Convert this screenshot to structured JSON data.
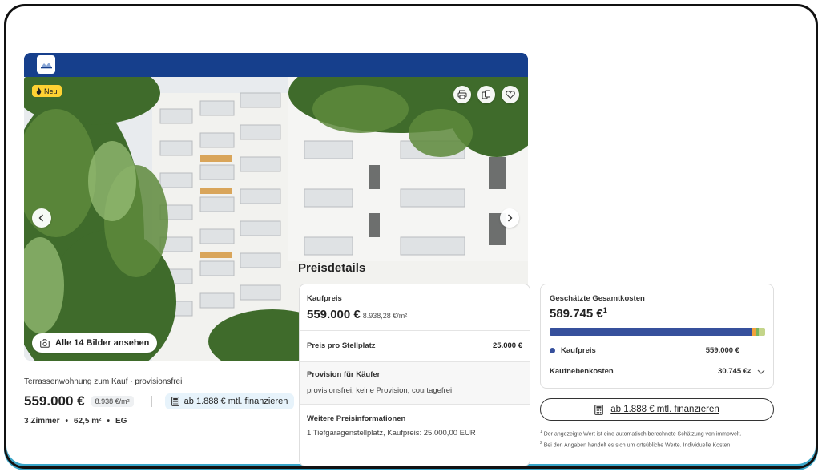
{
  "badge": {
    "new_label": "Neu"
  },
  "gallery": {
    "all_photos_label": "Alle 14 Bilder ansehen"
  },
  "listing": {
    "title": "Terrassenwohnung zum Kauf · provisionsfrei",
    "price": "559.000 €",
    "price_per_sqm": "8.938 €/m²",
    "finance_link": "ab 1.888 € mtl. finanzieren",
    "facts": [
      "3 Zimmer",
      "62,5 m²",
      "EG"
    ],
    "fact_separator": "•"
  },
  "price_details": {
    "title": "Preisdetails",
    "kaufpreis_label": "Kaufpreis",
    "kaufpreis_value": "559.000 €",
    "kaufpreis_sqm": "8.938,28 €/m²",
    "stellplatz_label": "Preis pro Stellplatz",
    "stellplatz_value": "25.000 €",
    "provision_label": "Provision für Käufer",
    "provision_text": "provisionsfrei; keine Provision, courtagefrei",
    "weitere_label": "Weitere Preisinformationen",
    "weitere_text": "1 Tiefgaragenstellplatz, Kaufpreis: 25.000,00 EUR"
  },
  "cost_estimate": {
    "label": "Geschätzte Gesamtkosten",
    "total": "589.745 €",
    "total_note": "1",
    "kaufpreis_label": "Kaufpreis",
    "kaufpreis_value": "559.000 €",
    "nebenkosten_label": "Kaufnebenkosten",
    "nebenkosten_value": "30.745 €",
    "nebenkosten_note": "2",
    "colors": {
      "kaufpreis": "#36509c",
      "seg2": "#f2a23c",
      "seg3": "#7ab55c",
      "seg4": "#c4d58a"
    }
  },
  "finance_button": {
    "label": "ab 1.888 € mtl. finanzieren"
  },
  "footnotes": {
    "n1": "1",
    "t1": "Der angezeigte Wert ist eine automatisch berechnete Schätzung von immowelt.",
    "n2": "2",
    "t2": "Bei den Angaben handelt es sich um ortsübliche Werte. Individuelle Kosten"
  },
  "icons": [
    "logo-icon",
    "fire-icon",
    "print-icon",
    "copy-icon",
    "heart-icon",
    "chevron-left-icon",
    "chevron-right-icon",
    "camera-icon",
    "calculator-icon",
    "chevron-down-icon"
  ]
}
